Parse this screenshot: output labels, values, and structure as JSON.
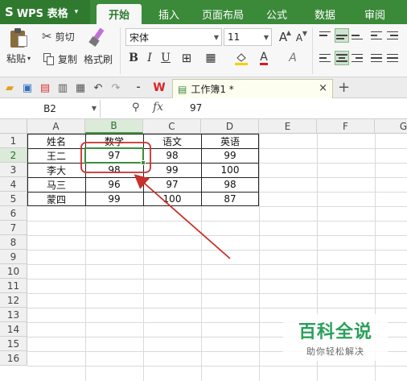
{
  "app": {
    "name": "WPS 表格",
    "logo_glyph": "S",
    "caret": "▾"
  },
  "menu": {
    "tabs": [
      {
        "label": "开始",
        "active": true
      },
      {
        "label": "插入",
        "active": false
      },
      {
        "label": "页面布局",
        "active": false
      },
      {
        "label": "公式",
        "active": false
      },
      {
        "label": "数据",
        "active": false
      },
      {
        "label": "审阅",
        "active": false
      }
    ]
  },
  "ribbon": {
    "paste_label": "粘贴",
    "cut_label": "剪切",
    "copy_label": "复制",
    "format_painter_label": "格式刷",
    "font_name": "宋体",
    "font_size": "11",
    "bold": "B",
    "italic": "I",
    "underline": "U",
    "grow_font": "A",
    "shrink_font": "A",
    "font_color": "A",
    "clear_format": "A"
  },
  "quick_access": {
    "doc_tab_title": "工作簿1 *",
    "close_glyph": "×",
    "plus_glyph": "+"
  },
  "formula_bar": {
    "name_box": "B2",
    "fx_label": "fx",
    "zoom_glyph": "⚲",
    "value": "97"
  },
  "sheet": {
    "columns": [
      "A",
      "B",
      "C",
      "D",
      "E",
      "F",
      "G"
    ],
    "rows": [
      "1",
      "2",
      "3",
      "4",
      "5",
      "6",
      "7",
      "8",
      "9",
      "10",
      "11",
      "12",
      "13",
      "14",
      "15",
      "16"
    ],
    "selected_col": "B",
    "selected_row": "2",
    "data": [
      [
        "姓名",
        "数学",
        "语文",
        "英语"
      ],
      [
        "王二",
        "97",
        "98",
        "99"
      ],
      [
        "李大",
        "98",
        "99",
        "100"
      ],
      [
        "马三",
        "96",
        "97",
        "98"
      ],
      [
        "蒙四",
        "99",
        "100",
        "87"
      ]
    ]
  },
  "annotation": {
    "color": "#c8312c"
  },
  "watermark": {
    "main": "百科全说",
    "sub": "助你轻松解决"
  },
  "colors": {
    "menu_green": "#3b8a3a",
    "app_green": "#2f7a2e",
    "selection_green": "#3c8f3b",
    "watermark_green": "#2aa05a"
  }
}
